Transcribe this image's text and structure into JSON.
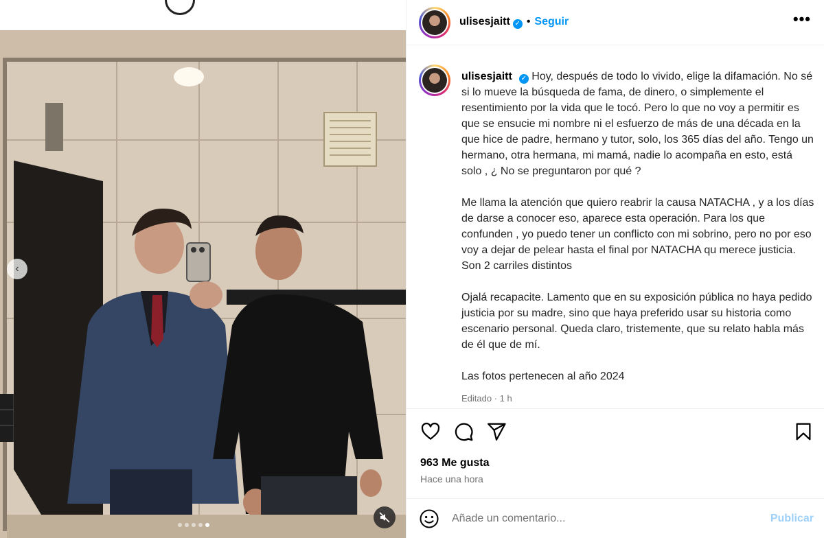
{
  "post": {
    "username": "ulisesjaitt",
    "follow_label": "Seguir",
    "more_label": "•••",
    "verified_glyph": "✓",
    "caption_paragraphs": [
      "Hoy, después de todo lo vivido, elige la difamación. No sé si lo mueve la búsqueda de fama, de dinero, o simplemente el resentimiento por la vida que le tocó. Pero lo que no voy a permitir es que se ensucie mi nombre ni el esfuerzo de más de una década en la que hice de padre, hermano y tutor, solo, los 365 días del año. Tengo un hermano, otra hermana, mi mamá, nadie lo acompaña en esto, está solo , ¿ No se preguntaron por qué ?",
      "Me llama la atención que quiero reabrir la causa NATACHA , y a los días de darse a conocer eso, aparece esta operación. Para los que confunden , yo puedo tener un conflicto con mi sobrino, pero no por eso voy a dejar de pelear hasta el final por NATACHA qu merece justicia. Son 2 carriles distintos",
      "Ojalá recapacite. Lamento que en su exposición pública no haya pedido justicia por su madre, sino que haya preferido usar su historia como escenario personal. Queda claro, tristemente, que su relato habla más de él que de mí.",
      "Las fotos pertenecen al año 2024"
    ],
    "edited_label": "Editado · 1 h",
    "likes_label": "963 Me gusta",
    "time_label": "Hace una hora"
  },
  "comment": {
    "placeholder": "Añade un comentario...",
    "publish_label": "Publicar"
  },
  "carousel": {
    "prev_glyph": "‹",
    "slide_count": 5,
    "active_index": 4
  },
  "icons": {
    "like": "heart-icon",
    "comment": "comment-icon",
    "share": "share-icon",
    "save": "bookmark-icon",
    "emoji": "emoji-icon",
    "mute": "muted-speaker-icon"
  },
  "colors": {
    "accent": "#0095f6",
    "publish_disabled": "#9fd1f9",
    "muted_text": "#737373"
  }
}
